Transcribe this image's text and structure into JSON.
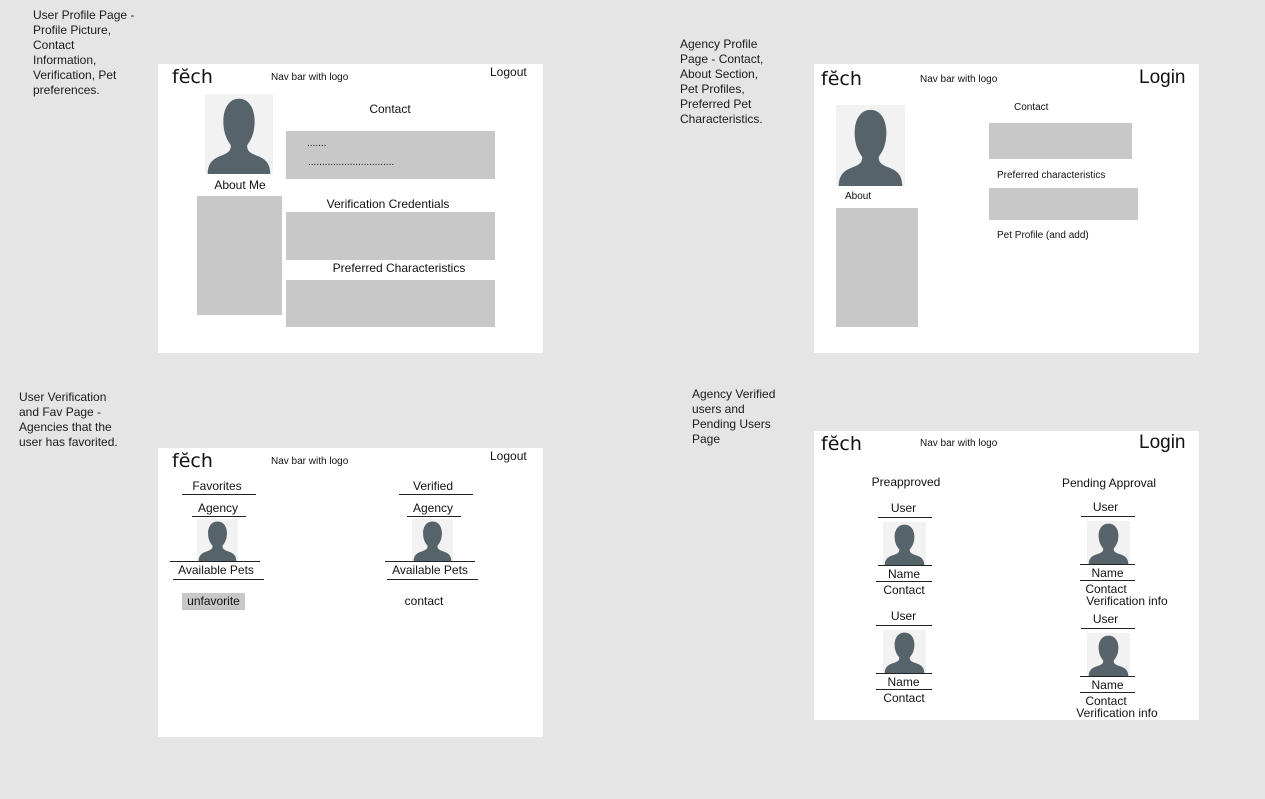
{
  "notes": {
    "user_profile": [
      "User Profile Page -",
      "Profile Picture,",
      "Contact",
      "Information,",
      "Verification, Pet",
      "preferences."
    ],
    "agency_profile": [
      "Agency Profile",
      "Page - Contact,",
      "About Section,",
      "Pet Profiles,",
      "Preferred Pet",
      "Characteristics."
    ],
    "user_verification": [
      "User Verification",
      "and Fav Page -",
      "Agencies that the",
      "user has favorited."
    ],
    "agency_verified": [
      "Agency Verified",
      "users and",
      "Pending Users",
      "Page"
    ]
  },
  "common": {
    "logo": "fĕch",
    "nav_label": "Nav bar with logo",
    "logout": "Logout",
    "login": "Login"
  },
  "user_profile": {
    "about_label": "About Me",
    "contact_label": "Contact",
    "contact_line1": ".......",
    "contact_line2": "...............................",
    "verification_label": "Verification Credentials",
    "preferred_label": "Preferred Characteristics"
  },
  "agency_profile": {
    "contact_label": "Contact",
    "about_label": "About",
    "preferred_label": "Preferred characteristics",
    "pet_profile_label": "Pet Profile (and add)"
  },
  "user_favorites": {
    "favorites": {
      "header": "Favorites",
      "agency": "Agency",
      "pets": "Available Pets",
      "action": "unfavorite"
    },
    "verified": {
      "header": "Verified",
      "agency": "Agency",
      "pets": "Available Pets",
      "action": "contact"
    }
  },
  "agency_users": {
    "preapproved": {
      "header": "Preapproved",
      "users": [
        {
          "user": "User",
          "name": "Name",
          "contact": "Contact"
        },
        {
          "user": "User",
          "name": "Name",
          "contact": "Contact"
        }
      ]
    },
    "pending": {
      "header": "Pending Approval",
      "users": [
        {
          "user": "User",
          "name": "Name",
          "contact": "Contact",
          "verification": "Verification info"
        },
        {
          "user": "User",
          "name": "Name",
          "contact": "Contact",
          "verification": "Verification info"
        }
      ]
    }
  },
  "colors": {
    "background": "#e5e5e5",
    "frame": "#ffffff",
    "placeholder_box": "#c8c8c8",
    "avatar": "#56636a"
  }
}
